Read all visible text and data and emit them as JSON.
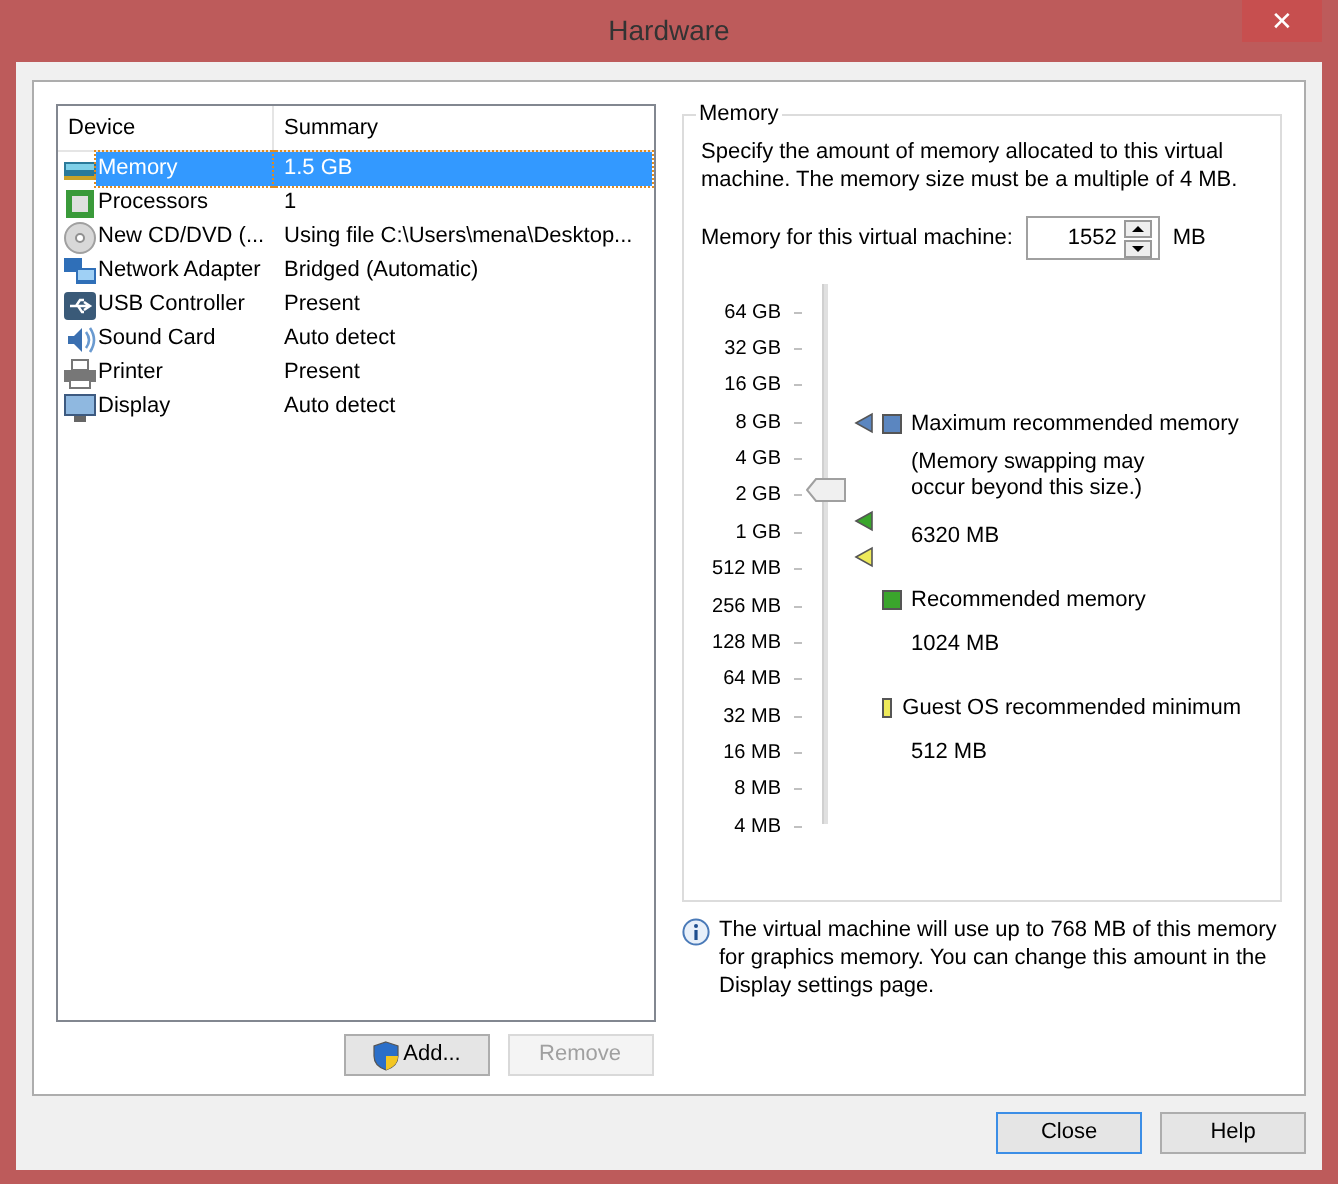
{
  "window": {
    "title": "Hardware",
    "close": "✕"
  },
  "device_list": {
    "columns": [
      "Device",
      "Summary"
    ],
    "rows": [
      {
        "kind": "memory",
        "device": "Memory",
        "summary": "1.5 GB",
        "selected": true
      },
      {
        "kind": "cpu",
        "device": "Processors",
        "summary": "1",
        "selected": false
      },
      {
        "kind": "disc",
        "device": "New CD/DVD (...",
        "summary": "Using file C:\\Users\\mena\\Desktop...",
        "selected": false
      },
      {
        "kind": "network",
        "device": "Network Adapter",
        "summary": "Bridged (Automatic)",
        "selected": false
      },
      {
        "kind": "usb",
        "device": "USB Controller",
        "summary": "Present",
        "selected": false
      },
      {
        "kind": "sound",
        "device": "Sound Card",
        "summary": "Auto detect",
        "selected": false
      },
      {
        "kind": "printer",
        "device": "Printer",
        "summary": "Present",
        "selected": false
      },
      {
        "kind": "display",
        "device": "Display",
        "summary": "Auto detect",
        "selected": false
      }
    ]
  },
  "list_buttons": [
    {
      "label": "Add...",
      "disabled": false,
      "shield": true
    },
    {
      "label": "Remove",
      "disabled": true,
      "shield": false
    }
  ],
  "memory": {
    "title": "Memory",
    "description": "Specify the amount of memory allocated to this virtual machine. The memory size must be a multiple of 4 MB.",
    "field_label": "Memory for this virtual machine:",
    "value": "1552",
    "unit": "MB",
    "scale": [
      "64 GB",
      "32 GB",
      "16 GB",
      "8 GB",
      "4 GB",
      "2 GB",
      "1 GB",
      "512 MB",
      "256 MB",
      "128 MB",
      "64 MB",
      "32 MB",
      "16 MB",
      "8 MB",
      "4 MB"
    ],
    "slider": {
      "level": 0.614
    },
    "legend": [
      {
        "label": "Maximum recommended memory",
        "note": "(Memory swapping may occur beyond this size.)",
        "value": "6320 MB",
        "color": "#5b86c0"
      },
      {
        "label": "Recommended memory",
        "value": "1024 MB",
        "color": "#3aa52c"
      },
      {
        "label": "Guest OS recommended minimum",
        "value": "512 MB",
        "color": "#eeea5a"
      }
    ]
  },
  "info": "The virtual machine will use up to 768 MB of this memory for graphics memory. You can change this amount in the Display settings page.",
  "buttons": [
    {
      "label": "Close",
      "default": true
    },
    {
      "label": "Help",
      "default": false
    }
  ]
}
